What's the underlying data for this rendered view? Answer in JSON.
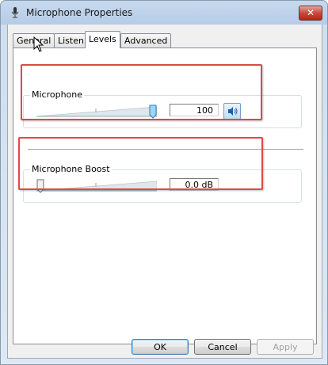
{
  "window": {
    "title": "Microphone Properties",
    "close_label": "✕"
  },
  "tabs": [
    {
      "label": "General",
      "active": false
    },
    {
      "label": "Listen",
      "active": false
    },
    {
      "label": "Levels",
      "active": true
    },
    {
      "label": "Advanced",
      "active": false
    }
  ],
  "microphone": {
    "label": "Microphone",
    "value": "100",
    "level": 1.0
  },
  "boost": {
    "label": "Microphone Boost",
    "value": "0.0 dB",
    "level": 0.0
  },
  "buttons": {
    "ok": "OK",
    "cancel": "Cancel",
    "apply": "Apply"
  },
  "colors": {
    "highlight": "#e04848",
    "accent": "#3c7fb1"
  }
}
